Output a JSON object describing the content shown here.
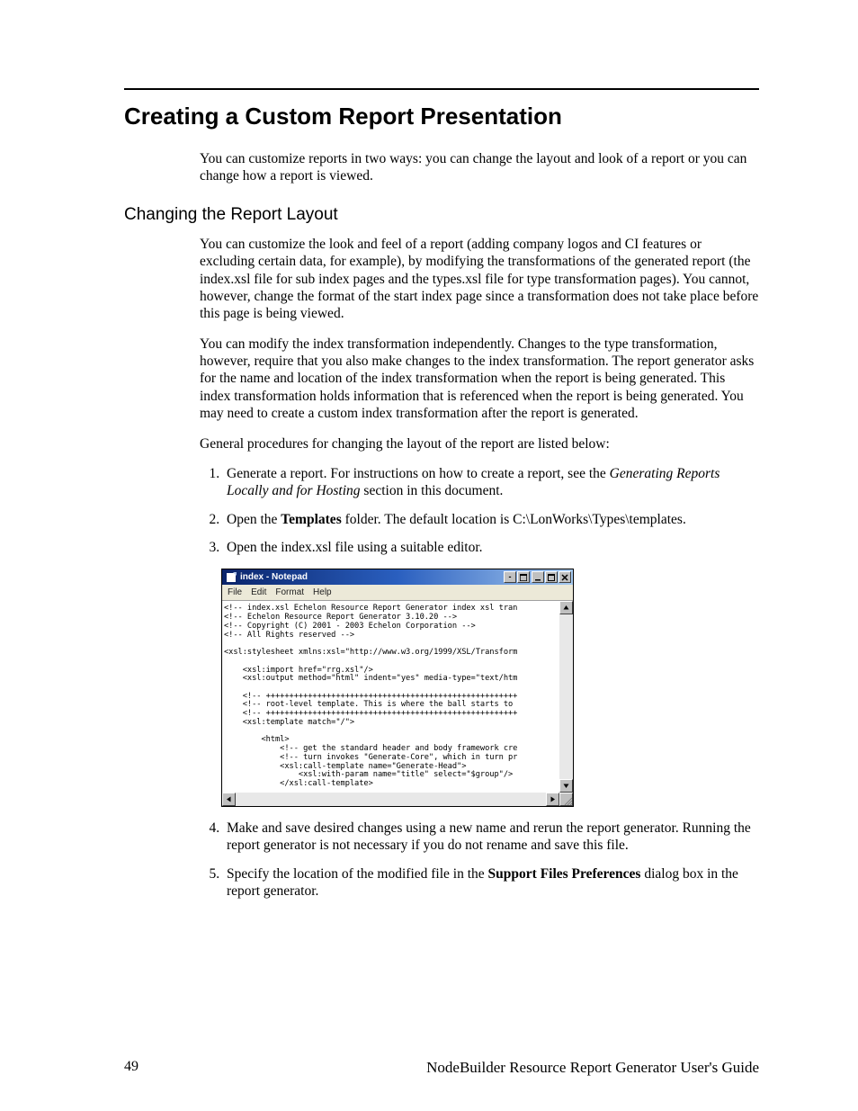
{
  "heading": "Creating a Custom Report Presentation",
  "intro": "You can customize reports in two ways: you can change the layout and look of a report or you can change how a report is viewed.",
  "subheading": "Changing the Report Layout",
  "p1": "You can customize the look and feel of a report (adding company logos and CI features or excluding certain data, for example), by modifying the transformations of the generated report (the index.xsl file for sub index pages and the types.xsl file for type transformation pages). You cannot, however, change the format of the start index page since a transformation does not take place before this page is being viewed.",
  "p2": "You can modify the index transformation independently. Changes to the type transformation, however, require that you also make changes to the index transformation. The report generator asks for the name and location of the index transformation when the report is being generated. This index transformation holds information that is referenced when the report is being generated. You may need to create a custom index transformation after the report is generated.",
  "p3": "General procedures for changing the layout of the report are listed below:",
  "steps": {
    "s1a": "Generate a report. For instructions on how to create a report, see the ",
    "s1_em": "Generating Reports Locally and for Hosting",
    "s1b": " section in this document.",
    "s2a": "Open the ",
    "s2_strong": "Templates",
    "s2b": " folder. The default location is C:\\LonWorks\\Types\\templates.",
    "s3": "Open the index.xsl file using a suitable editor.",
    "s4": "Make and save desired changes using a new name and rerun the report generator. Running the report generator is not necessary if you do not rename and save this file.",
    "s5a": "Specify the location of the modified file in the ",
    "s5_strong": "Support Files Preferences",
    "s5b": " dialog box in the report generator."
  },
  "notepad": {
    "title": "index - Notepad",
    "menus": [
      "File",
      "Edit",
      "Format",
      "Help"
    ],
    "content": "<!-- index.xsl Echelon Resource Report Generator index xsl tran\n<!-- Echelon Resource Report Generator 3.10.20 -->\n<!-- Copyright (C) 2001 - 2003 Echelon Corporation -->\n<!-- All Rights reserved -->\n\n<xsl:stylesheet xmlns:xsl=\"http://www.w3.org/1999/XSL/Transform\n\n    <xsl:import href=\"rrg.xsl\"/>\n    <xsl:output method=\"html\" indent=\"yes\" media-type=\"text/htm\n\n    <!-- ++++++++++++++++++++++++++++++++++++++++++++++++++++++\n    <!-- root-level template. This is where the ball starts to\n    <!-- ++++++++++++++++++++++++++++++++++++++++++++++++++++++\n    <xsl:template match=\"/\">\n\n        <html>\n            <!-- get the standard header and body framework cre\n            <!-- turn invokes \"Generate-Core\", which in turn pr\n            <xsl:call-template name=\"Generate-Head\">\n                <xsl:with-param name=\"title\" select=\"$group\"/>\n            </xsl:call-template>"
  },
  "footer": {
    "page": "49",
    "doc": "NodeBuilder Resource Report Generator User's Guide"
  }
}
